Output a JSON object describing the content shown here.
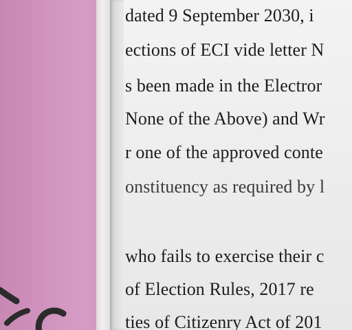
{
  "document": {
    "lines": [
      "dated 9 September 2030, i",
      "ections of ECI vide letter N",
      "s been made in the Electror",
      "None of the Above) and Wr",
      "r one of the approved conte",
      "onstituency as required by l",
      "who fails to exercise their c",
      "of Election Rules, 2017 re",
      "ties of Citizenry Act of 201"
    ]
  },
  "colors": {
    "pink_sheet": "#cf92bd",
    "paper": "#ededed",
    "ink": "#1d1d1d",
    "pen_mark": "#2b2b2b"
  }
}
